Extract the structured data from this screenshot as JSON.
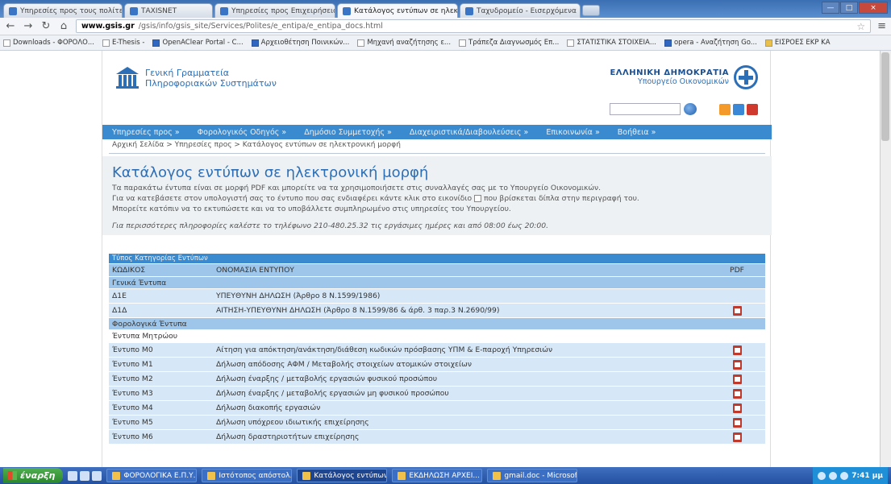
{
  "browser": {
    "tabs": [
      {
        "label": "Υπηρεσίες προς τους πολίτες"
      },
      {
        "label": "ΤΑΧΙSΝΕΤ"
      },
      {
        "label": "Υπηρεσίες προς Επιχειρήσεις"
      },
      {
        "label": "Κατάλογος εντύπων σε ηλεκτρονική"
      },
      {
        "label": "Ταχυδρομείο - Εισερχόμενα"
      }
    ],
    "url_host": "www.gsis.gr",
    "url_path": "/gsis/info/gsis_site/Services/Polites/e_entipa/e_entipa_docs.html",
    "bookmarks": [
      {
        "label": "Downloads - ΦΟΡΟΛΟ...",
        "icon": "file-icon"
      },
      {
        "label": "E-Thesis -",
        "icon": "file-icon"
      },
      {
        "label": "OpenAClear Portal - C...",
        "icon": "blue-icon"
      },
      {
        "label": "Αρχειοθέτηση Ποινικών...",
        "icon": "blue-icon"
      },
      {
        "label": "Μηχανή αναζήτησης ε...",
        "icon": "file-icon"
      },
      {
        "label": "Τράπεζα Διαγνωσμός Επ...",
        "icon": "file-icon"
      },
      {
        "label": "ΣΤΑΤΙΣΤΙΚΑ ΣΤΟΙΧΕΙΑ...",
        "icon": "file-icon"
      },
      {
        "label": "opera - Αναζήτηση Go...",
        "icon": "blue-icon"
      },
      {
        "label": "ΕΙΣΡΟΕΣ ΕΚΡ ΚΑ",
        "icon": "folder-icon"
      }
    ]
  },
  "site": {
    "org_line1": "Γενική Γραμματεία",
    "org_line2": "Πληροφοριακών Συστημάτων",
    "state_line1": "ΕΛΛΗΝΙΚΗ ΔΗΜΟΚΡΑΤΙΑ",
    "state_line2": "Υπουργείο Οικονομικών"
  },
  "nav": {
    "items": [
      "Υπηρεσίες προς »",
      "Φορολογικός Οδηγός »",
      "Δημόσιο Συμμετοχής »",
      "Διαχειριστικά/Διαβουλεύσεις »",
      "Επικοινωνία »",
      "Βοήθεια »"
    ],
    "breadcrumb": "Αρχική Σελίδα > Υπηρεσίες προς > Κατάλογος εντύπων σε ηλεκτρονική μορφή"
  },
  "intro": {
    "title": "Κατάλογος εντύπων σε ηλεκτρονική μορφή",
    "line1": "Τα παρακάτω έντυπα είναι σε μορφή PDF και μπορείτε να τα χρησιμοποιήσετε στις συναλλαγές σας με το Υπουργείο Οικονομικών.",
    "line2a": "Για να κατεβάσετε στον υπολογιστή σας το έντυπο που σας ενδιαφέρει κάντε κλικ στο εικονίδιο",
    "line2b": "που βρίσκεται δίπλα στην περιγραφή του.",
    "line3": "Μπορείτε κατόπιν να το εκτυπώσετε και να το υποβάλλετε συμπληρωμένο στις υπηρεσίες του Υπουργείου.",
    "note": "Για περισσότερες πληροφορίες καλέστε το τηλέφωνο 210-480.25.32 τις εργάσιμες ημέρες και από 08:00 έως 20:00."
  },
  "table": {
    "category": "Τύπος Κατηγορίας Εντύπων",
    "col_code": "ΚΩΔΙΚΟΣ",
    "col_name": "ΟΝΟΜΑΣΙΑ ΕΝΤΥΠΟΥ",
    "col_pdf": "PDF",
    "group1": "Γενικά Έντυπα",
    "rows1": [
      {
        "code": "Δ1Ε",
        "name": "ΥΠΕΥΘΥΝΗ ΔΗΛΩΣΗ (Άρθρο 8 Ν.1599/1986)",
        "pdf": false
      },
      {
        "code": "Δ1Δ",
        "name": "ΑΙΤΗΣΗ-ΥΠΕΥΘΥΝΗ ΔΗΛΩΣΗ (Άρθρο 8 Ν.1599/86 & άρθ. 3 παρ.3 Ν.2690/99)",
        "pdf": true
      }
    ],
    "group2": "Φορολογικά Έντυπα",
    "subgroup": "Έντυπα Μητρώου",
    "rows2": [
      {
        "code": "Έντυπο Μ0",
        "name": "Αίτηση για απόκτηση/ανάκτηση/διάθεση κωδικών πρόσβασης ΥΠΜ & Ε-παροχή Υπηρεσιών",
        "pdf": true
      },
      {
        "code": "Έντυπο Μ1",
        "name": "Δήλωση απόδοσης ΑΦΜ / Μεταβολής στοιχείων ατομικών στοιχείων",
        "pdf": true
      },
      {
        "code": "Έντυπο Μ2",
        "name": "Δήλωση έναρξης / μεταβολής εργασιών φυσικού προσώπου",
        "pdf": true
      },
      {
        "code": "Έντυπο Μ3",
        "name": "Δήλωση έναρξης / μεταβολής εργασιών μη φυσικού προσώπου",
        "pdf": true
      },
      {
        "code": "Έντυπο Μ4",
        "name": "Δήλωση διακοπής εργασιών",
        "pdf": true
      },
      {
        "code": "Έντυπο Μ5",
        "name": "Δήλωση υπόχρεου ιδιωτικής επιχείρησης",
        "pdf": true
      },
      {
        "code": "Έντυπο Μ6",
        "name": "Δήλωση δραστηριοτήτων επιχείρησης",
        "pdf": true
      }
    ]
  },
  "taskbar": {
    "start": "έναρξη",
    "tasks": [
      "ΦΟΡΟΛΟΓΙΚΑ Ε.Π.Υ.",
      "Ιστότοπος απόστολ...",
      "Κατάλογος εντύπων ...",
      "ΕΚΔΗΛΩΣΗ ΑΡΧΕΙ...",
      "gmail.doc - Microsof..."
    ],
    "clock": "7:41 μμ"
  }
}
